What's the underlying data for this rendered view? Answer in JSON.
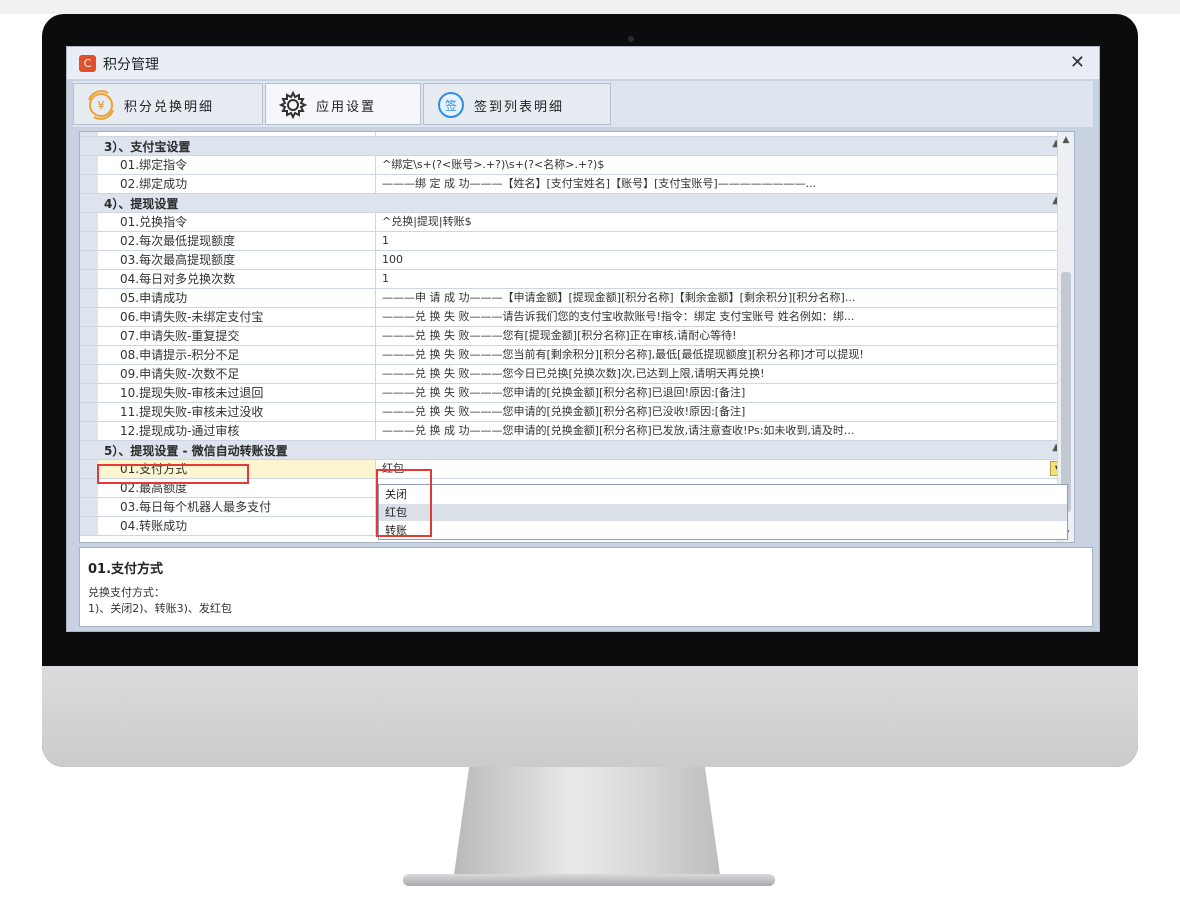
{
  "window": {
    "title": "积分管理",
    "app_icon_glyph": "C",
    "close_glyph": "✕"
  },
  "tabs": [
    {
      "label": "积分兑换明细",
      "icon": "yuan-exchange-icon"
    },
    {
      "label": "应用设置",
      "icon": "gear-icon"
    },
    {
      "label": "签到列表明细",
      "icon": "sign-in-icon",
      "icon_text": "签"
    }
  ],
  "grid": {
    "partial_top": {
      "name": "",
      "value": ""
    },
    "categories": [
      {
        "label": "3）、支付宝设置",
        "rows": [
          {
            "name": "01.绑定指令",
            "value": "^绑定\\s+(?<账号>.+?)\\s+(?<名称>.+?)$"
          },
          {
            "name": "02.绑定成功",
            "value": "———绑 定 成 功———【姓名】[支付宝姓名]【账号】[支付宝账号]————————..."
          }
        ]
      },
      {
        "label": "4）、提现设置",
        "rows": [
          {
            "name": "01.兑换指令",
            "value": "^兑换|提现|转账$"
          },
          {
            "name": "02.每次最低提现额度",
            "value": "1"
          },
          {
            "name": "03.每次最高提现额度",
            "value": "100"
          },
          {
            "name": "04.每日对多兑换次数",
            "value": "1"
          },
          {
            "name": "05.申请成功",
            "value": "———申 请 成 功———【申请金额】[提现金额][积分名称]【剩余金额】[剩余积分][积分名称]..."
          },
          {
            "name": "06.申请失败-未绑定支付宝",
            "value": "———兑 换 失 败———请告诉我们您的支付宝收款账号!指令：绑定 支付宝账号 姓名例如：绑..."
          },
          {
            "name": "07.申请失败-重复提交",
            "value": "———兑 换 失 败———您有[提现金额][积分名称]正在审核,请耐心等待!"
          },
          {
            "name": "08.申请提示-积分不足",
            "value": "———兑 换 失 败———您当前有[剩余积分][积分名称],最低[最低提现额度][积分名称]才可以提现!"
          },
          {
            "name": "09.申请失败-次数不足",
            "value": "———兑 换 失 败———您今日已兑换[兑换次数]次,已达到上限,请明天再兑换!"
          },
          {
            "name": "10.提现失败-审核未过退回",
            "value": "———兑 换 失 败———您申请的[兑换金额][积分名称]已退回!原因:[备注]"
          },
          {
            "name": "11.提现失败-审核未过没收",
            "value": "———兑 换 失 败———您申请的[兑换金额][积分名称]已没收!原因:[备注]"
          },
          {
            "name": "12.提现成功-通过审核",
            "value": "———兑 换 成 功———您申请的[兑换金额][积分名称]已发放,请注意查收!Ps:如未收到,请及时..."
          }
        ]
      },
      {
        "label": "5）、提现设置 - 微信自动转账设置",
        "rows": [
          {
            "name": "01.支付方式",
            "value": "红包",
            "selected": true
          },
          {
            "name": "02.最高额度",
            "value": ""
          },
          {
            "name": "03.每日每个机器人最多支付",
            "value": ""
          },
          {
            "name": "04.转账成功",
            "value": ""
          }
        ]
      }
    ],
    "collapse_glyph": "▲",
    "dropdown_glyph": "▼"
  },
  "dropdown": {
    "options": [
      "关闭",
      "红包",
      "转账"
    ],
    "hover_index": 1
  },
  "description": {
    "title": "01.支付方式",
    "line1": "兑换支付方式：",
    "line2": "1)、关闭2)、转账3)、发红包"
  },
  "colors": {
    "highlight_red": "#e53935",
    "category_bg": "#dde4ee",
    "window_bg": "#c8d2e0"
  }
}
